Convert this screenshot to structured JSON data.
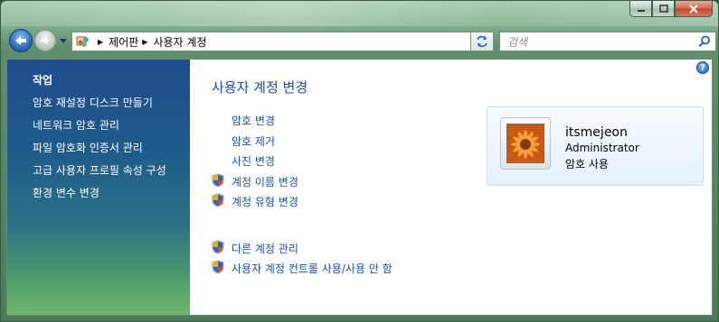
{
  "address": {
    "crumbs": [
      "제어판",
      "사용자 계정"
    ],
    "search_placeholder": "검색"
  },
  "left_pane": {
    "title": "작업",
    "tasks": [
      "암호 재설정 디스크 만들기",
      "네트워크 암호 관리",
      "파일 암호화 인증서 관리",
      "고급 사용자 프로필 속성 구성",
      "환경 변수 변경"
    ]
  },
  "main": {
    "heading": "사용자 계정 변경",
    "links": [
      {
        "label": "암호 변경",
        "shield": false
      },
      {
        "label": "암호 제거",
        "shield": false
      },
      {
        "label": "사진 변경",
        "shield": false
      },
      {
        "label": "계정 이름 변경",
        "shield": true
      },
      {
        "label": "계정 유형 변경",
        "shield": true
      }
    ],
    "other_links": [
      {
        "label": "다른 계정 관리",
        "shield": true
      },
      {
        "label": "사용자 계정 컨트롤 사용/사용 안 함",
        "shield": true
      }
    ]
  },
  "user": {
    "name": "itsmejeon",
    "role": "Administrator",
    "password_status": "암호 사용"
  },
  "icons": {
    "back": "back-arrow-icon",
    "forward": "forward-arrow-icon",
    "refresh": "refresh-icon",
    "search": "search-icon",
    "help": "help-icon",
    "shield": "uac-shield-icon",
    "control_panel": "control-panel-icon"
  },
  "colors": {
    "link": "#1a52a8",
    "heading": "#1f4c99",
    "left_pane_top": "#1f4d8e",
    "left_pane_bottom": "#6fb86a"
  }
}
